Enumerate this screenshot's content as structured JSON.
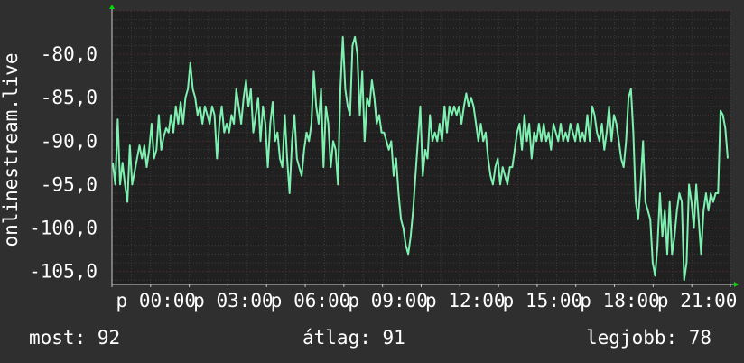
{
  "chart_data": {
    "type": "line",
    "ylabel": "onlinestream.live",
    "y_ticks": [
      -80,
      -85,
      -90,
      -95,
      -100,
      -105
    ],
    "y_tick_labels": [
      "-80,0",
      "-85,0",
      "-90,0",
      "-95,0",
      "-100,0",
      "-105,0"
    ],
    "ylim": [
      -106.5,
      -75.0
    ],
    "x_tick_labels": [
      "p 00:00",
      "p 03:00",
      "p 06:00",
      "p 09:00",
      "p 12:00",
      "p 15:00",
      "p 18:00",
      "p 21:00"
    ],
    "xlim": [
      0,
      24
    ],
    "grid": true,
    "series": [
      {
        "color": "#7ef0b0",
        "values": [
          -92.5,
          -95,
          -87.5,
          -95,
          -92.5,
          -95,
          -97,
          -90.5,
          -95,
          -93.5,
          -92,
          -90.5,
          -92,
          -90.5,
          -93,
          -91,
          -88,
          -92,
          -91,
          -87,
          -91,
          -89.5,
          -88.5,
          -89,
          -87,
          -89,
          -86,
          -88,
          -85.5,
          -88,
          -85,
          -84,
          -81,
          -84,
          -85,
          -87,
          -86,
          -88,
          -86,
          -87,
          -88,
          -86,
          -87,
          -92,
          -88,
          -86,
          -89,
          -88,
          -89,
          -87,
          -88,
          -84,
          -86,
          -88,
          -85,
          -83,
          -86,
          -84,
          -89,
          -87,
          -85,
          -90,
          -86,
          -88,
          -93,
          -88,
          -85.5,
          -90,
          -89,
          -92,
          -93,
          -87,
          -92,
          -96,
          -90,
          -87,
          -92,
          -93,
          -94,
          -91,
          -89,
          -90,
          -88,
          -82,
          -86,
          -88,
          -84,
          -93,
          -86,
          -88,
          -93,
          -90,
          -91,
          -95,
          -84,
          -78,
          -84,
          -86,
          -87,
          -79,
          -78,
          -80,
          -87,
          -82,
          -90,
          -85,
          -86,
          -83,
          -85,
          -88,
          -87,
          -89,
          -89,
          -90,
          -91,
          -90,
          -94,
          -92,
          -96,
          -99,
          -100,
          -102,
          -103,
          -101,
          -98,
          -94,
          -90,
          -86,
          -94,
          -91,
          -92,
          -87,
          -90,
          -89,
          -90,
          -88,
          -90,
          -86,
          -89,
          -86,
          -87,
          -86,
          -87,
          -86,
          -88,
          -86,
          -84.5,
          -86,
          -85,
          -86,
          -88,
          -90,
          -88,
          -90,
          -89,
          -92,
          -94,
          -95,
          -93,
          -92,
          -95,
          -93,
          -94,
          -95,
          -93,
          -93,
          -91,
          -89,
          -88,
          -91,
          -87,
          -90,
          -88,
          -92,
          -89,
          -90,
          -88,
          -90,
          -88,
          -90,
          -89,
          -91,
          -88,
          -89,
          -90,
          -88,
          -90,
          -89,
          -90,
          -88,
          -89,
          -90,
          -88,
          -90,
          -89,
          -90,
          -87,
          -90,
          -86,
          -87,
          -89,
          -90,
          -88,
          -91,
          -89,
          -86,
          -90,
          -87,
          -88,
          -90,
          -92,
          -93,
          -90,
          -85,
          -84,
          -89,
          -97,
          -99,
          -95,
          -90,
          -97,
          -98,
          -99,
          -104,
          -105.5,
          -102,
          -96,
          -101,
          -98,
          -103,
          -97,
          -103,
          -101,
          -98,
          -96,
          -97,
          -106,
          -104,
          -95,
          -97,
          -100,
          -95,
          -99,
          -103,
          -98,
          -96,
          -98,
          -96,
          -97,
          -96,
          -96,
          -86.5,
          -87,
          -88.5,
          -92
        ]
      }
    ]
  },
  "footer": {
    "current": "most: 92",
    "average": "átlag: 91",
    "best": "legjobb: 78"
  },
  "colors": {
    "background": "#2f2f2f",
    "plot_background": "#202020",
    "grid": "#3c3c3c",
    "axis": "#c8c8c8",
    "arrow": "#00dd00",
    "line": "#7ef0b0"
  }
}
